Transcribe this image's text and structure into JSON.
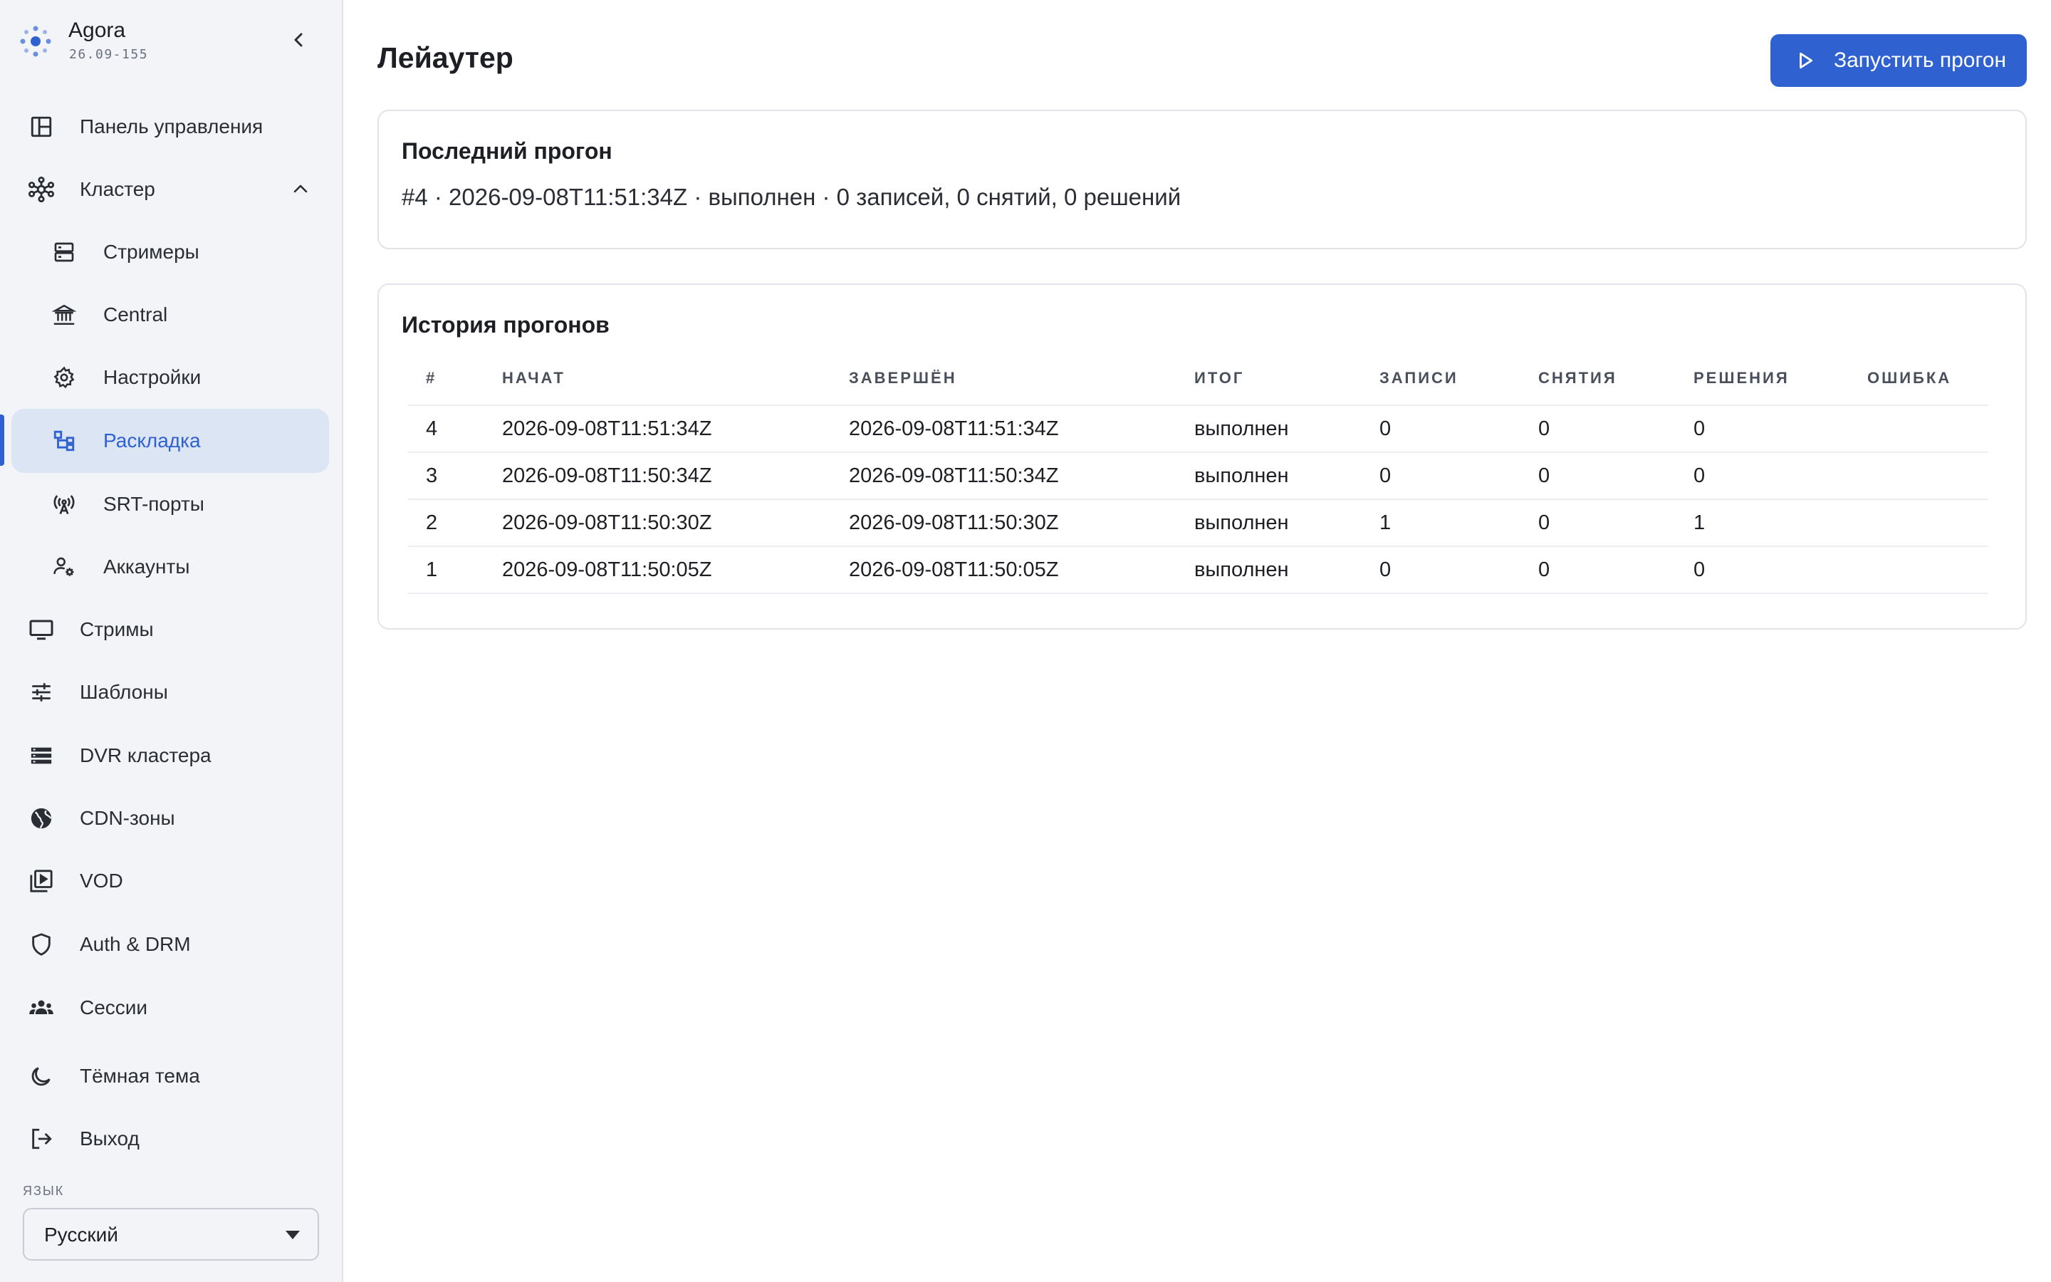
{
  "app": {
    "name": "Agora",
    "version": "26.09-155"
  },
  "sidebar": {
    "items": [
      {
        "label": "Панель управления",
        "icon": "dashboard-icon"
      },
      {
        "label": "Кластер",
        "icon": "cluster-icon"
      },
      {
        "label": "Стримеры",
        "icon": "server-icon"
      },
      {
        "label": "Central",
        "icon": "bank-icon"
      },
      {
        "label": "Настройки",
        "icon": "gear-icon"
      },
      {
        "label": "Раскладка",
        "icon": "layout-tree-icon",
        "active": true
      },
      {
        "label": "SRT-порты",
        "icon": "antenna-icon"
      },
      {
        "label": "Аккаунты",
        "icon": "user-gear-icon"
      },
      {
        "label": "Стримы",
        "icon": "monitor-icon"
      },
      {
        "label": "Шаблоны",
        "icon": "sliders-icon"
      },
      {
        "label": "DVR кластера",
        "icon": "storage-icon"
      },
      {
        "label": "CDN-зоны",
        "icon": "globe-icon"
      },
      {
        "label": "VOD",
        "icon": "video-library-icon"
      },
      {
        "label": "Auth & DRM",
        "icon": "shield-icon"
      },
      {
        "label": "Сессии",
        "icon": "users-icon"
      },
      {
        "label": "Тёмная тема",
        "icon": "moon-icon"
      },
      {
        "label": "Выход",
        "icon": "logout-icon"
      }
    ],
    "language": {
      "label": "ЯЗЫК",
      "value": "Русский"
    }
  },
  "page": {
    "title": "Лейаутер",
    "run_button": "Запустить прогон"
  },
  "last_run": {
    "title": "Последний прогон",
    "summary": "#4 · 2026-09-08T11:51:34Z · выполнен · 0 записей, 0 снятий, 0 решений"
  },
  "history": {
    "title": "История прогонов",
    "columns": [
      "#",
      "НАЧАТ",
      "ЗАВЕРШЁН",
      "ИТОГ",
      "ЗАПИСИ",
      "СНЯТИЯ",
      "РЕШЕНИЯ",
      "ОШИБКА"
    ],
    "rows": [
      [
        "4",
        "2026-09-08T11:51:34Z",
        "2026-09-08T11:51:34Z",
        "выполнен",
        "0",
        "0",
        "0",
        ""
      ],
      [
        "3",
        "2026-09-08T11:50:34Z",
        "2026-09-08T11:50:34Z",
        "выполнен",
        "0",
        "0",
        "0",
        ""
      ],
      [
        "2",
        "2026-09-08T11:50:30Z",
        "2026-09-08T11:50:30Z",
        "выполнен",
        "1",
        "0",
        "1",
        ""
      ],
      [
        "1",
        "2026-09-08T11:50:05Z",
        "2026-09-08T11:50:05Z",
        "выполнен",
        "0",
        "0",
        "0",
        ""
      ]
    ]
  },
  "colors": {
    "accent": "#2f62d0",
    "sidebar_bg": "#f3f4f7",
    "active_bg": "#dce5f4"
  }
}
